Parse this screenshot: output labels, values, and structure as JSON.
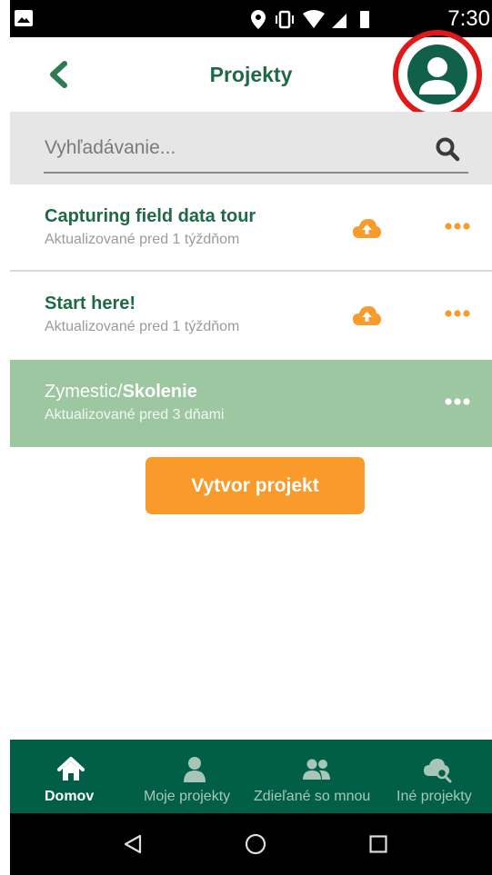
{
  "status_bar": {
    "time": "7:30"
  },
  "header": {
    "title": "Projekty"
  },
  "search": {
    "placeholder": "Vyhľadávanie...",
    "value": ""
  },
  "projects": [
    {
      "title": "Capturing field data tour",
      "subtitle": "Aktualizované pred 1 týždňom",
      "synced": false
    },
    {
      "title": "Start here!",
      "subtitle": "Aktualizované pred 1 týždňom",
      "synced": false
    },
    {
      "title_prefix": "Zymestic/",
      "title_bold": "Skolenie",
      "subtitle": "Aktualizované pred 3 dňami",
      "selected": true
    }
  ],
  "create_button": {
    "label": "Vytvor projekt"
  },
  "bottom_nav": [
    {
      "label": "Domov",
      "icon": "home-icon",
      "active": true
    },
    {
      "label": "Moje projekty",
      "icon": "user-icon",
      "active": false
    },
    {
      "label": "Zdieľané so mnou",
      "icon": "users-icon",
      "active": false
    },
    {
      "label": "Iné projekty",
      "icon": "cloud-search-icon",
      "active": false
    }
  ],
  "colors": {
    "primary": "#005f46",
    "title_green": "#1f6a46",
    "accent_orange": "#f99a2b",
    "selected_row": "#9cc7a1",
    "highlight_ring": "#e01818"
  }
}
